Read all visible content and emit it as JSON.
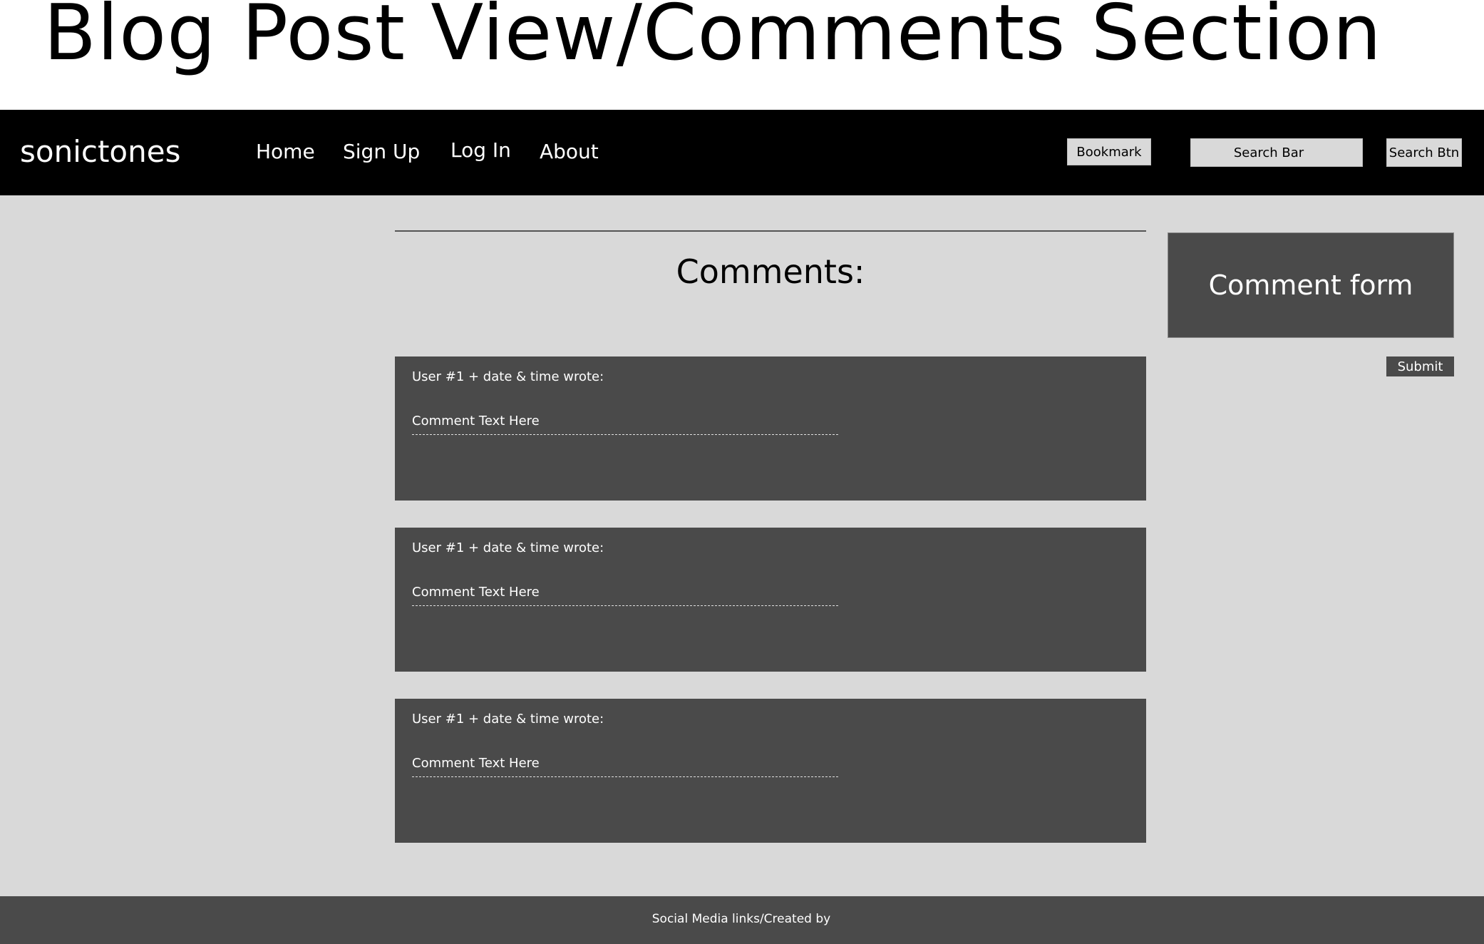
{
  "page_heading": "Blog Post View/Comments Section",
  "navbar": {
    "brand": "sonictones",
    "links": [
      "Home",
      "Sign Up",
      "Log In",
      "About"
    ],
    "bookmark_label": "Bookmark",
    "search_placeholder": "Search Bar",
    "search_button_label": "Search Btn"
  },
  "main": {
    "comments_title": "Comments:",
    "comments": [
      {
        "meta": "User #1 + date & time wrote:",
        "text": "Comment Text Here"
      },
      {
        "meta": "User #1 + date & time wrote:",
        "text": "Comment Text Here"
      },
      {
        "meta": "User #1 + date & time wrote:",
        "text": "Comment Text Here"
      }
    ]
  },
  "sidebar": {
    "comment_form_label": "Comment form",
    "submit_label": "Submit"
  },
  "footer": {
    "text": "Social Media links/Created by"
  },
  "colors": {
    "navbar_bg": "#000000",
    "content_bg": "#d9d9d9",
    "card_bg": "#4a4a4a",
    "footer_bg": "#4a4a4a"
  }
}
